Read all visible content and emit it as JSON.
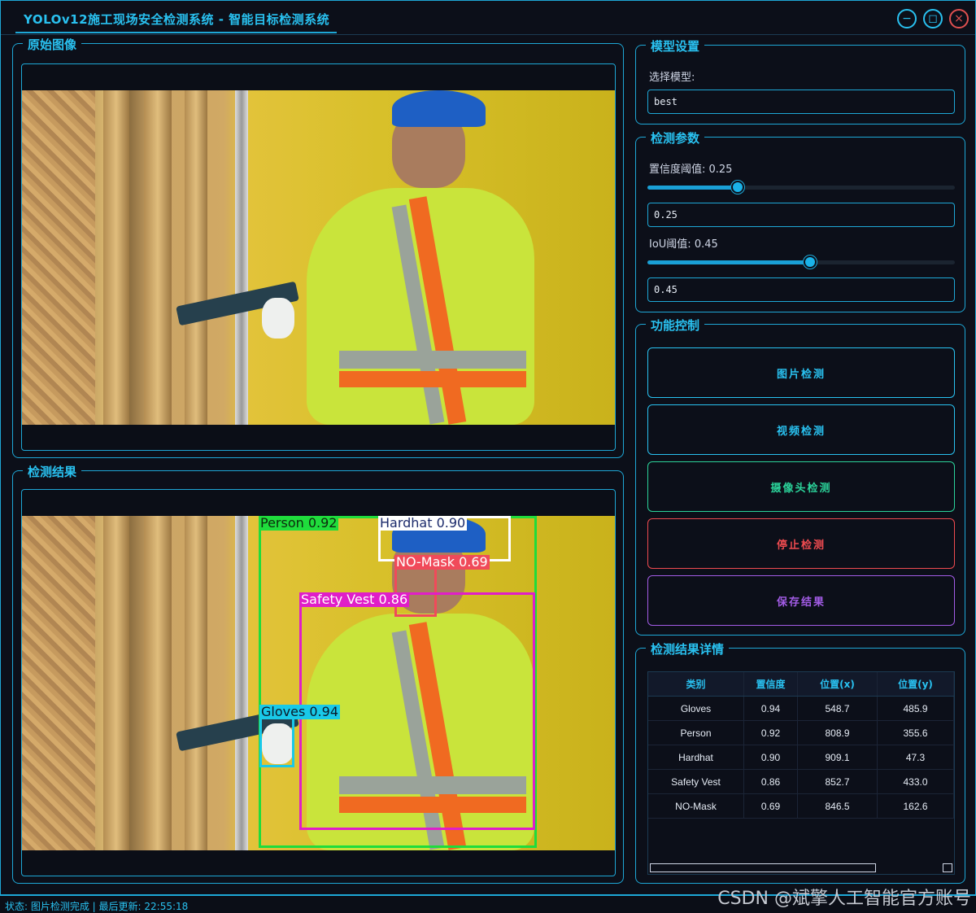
{
  "window": {
    "title": "YOLOv12施工现场安全检测系统 - 智能目标检测系统",
    "minimize_icon": "−",
    "maximize_icon": "◻",
    "close_icon": "×"
  },
  "original_panel": {
    "title": "原始图像"
  },
  "result_panel": {
    "title": "检测结果",
    "detections": [
      {
        "label": "Person 0.92",
        "color": "#1fdc3c",
        "text_color": "#0d2a0d"
      },
      {
        "label": "Hardhat 0.90",
        "color": "#ffffff",
        "text_color": "#1b2a6b"
      },
      {
        "label": "NO-Mask 0.69",
        "color": "#f04a5a",
        "text_color": "#ffffff"
      },
      {
        "label": "Safety Vest 0.86",
        "color": "#e01ec8",
        "text_color": "#ffffff"
      },
      {
        "label": "Gloves 0.94",
        "color": "#19c9e8",
        "text_color": "#0a1a2a"
      }
    ]
  },
  "model_settings": {
    "title": "模型设置",
    "select_label": "选择模型:",
    "model_value": "best"
  },
  "detection_params": {
    "title": "检测参数",
    "confidence_label": "置信度阈值: 0.25",
    "confidence_value": "0.25",
    "confidence_level": 0.25,
    "iou_label": "IoU阈值: 0.45",
    "iou_value": "0.45",
    "iou_level": 0.45
  },
  "function_control": {
    "title": "功能控制",
    "buttons": [
      {
        "label": "图片检测",
        "color": "#29c1f0"
      },
      {
        "label": "视频检测",
        "color": "#29c1f0"
      },
      {
        "label": "摄像头检测",
        "color": "#2bd39a"
      },
      {
        "label": "停止检测",
        "color": "#ef4b50"
      },
      {
        "label": "保存结果",
        "color": "#a35ce6"
      }
    ]
  },
  "results_detail": {
    "title": "检测结果详情",
    "columns": [
      "类别",
      "置信度",
      "位置(x)",
      "位置(y)"
    ],
    "rows": [
      [
        "Gloves",
        "0.94",
        "548.7",
        "485.9"
      ],
      [
        "Person",
        "0.92",
        "808.9",
        "355.6"
      ],
      [
        "Hardhat",
        "0.90",
        "909.1",
        "47.3"
      ],
      [
        "Safety Vest",
        "0.86",
        "852.7",
        "433.0"
      ],
      [
        "NO-Mask",
        "0.69",
        "846.5",
        "162.6"
      ]
    ]
  },
  "status_bar": {
    "text": "状态: 图片检测完成 | 最后更新: 22:55:18"
  },
  "watermark": "CSDN @斌擎人工智能官方账号"
}
